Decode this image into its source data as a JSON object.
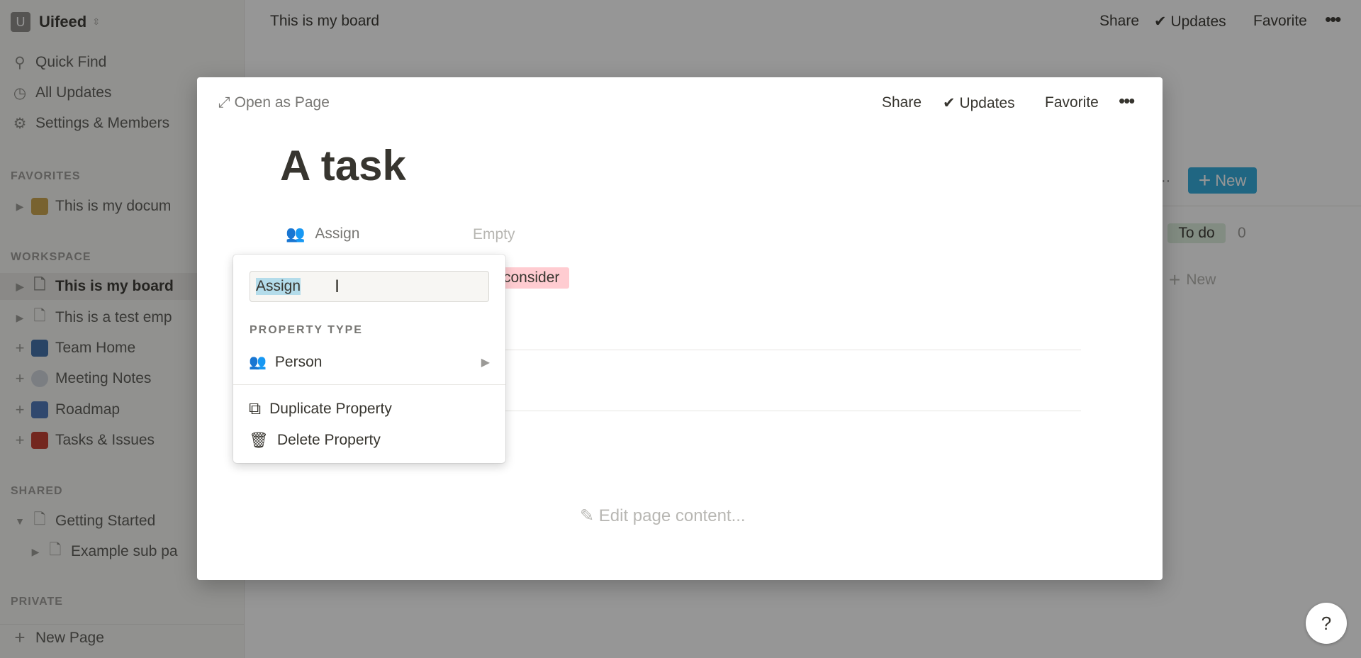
{
  "workspace": {
    "initial": "U",
    "name": "Uifeed"
  },
  "sidebar": {
    "nav": [
      {
        "label": "Quick Find",
        "icon": "search-icon"
      },
      {
        "label": "All Updates",
        "icon": "clock-icon"
      },
      {
        "label": "Settings & Members",
        "icon": "gear-icon"
      }
    ],
    "favorites_heading": "FAVORITES",
    "favorites": [
      {
        "label": "This is my docum",
        "icon": "scared-cat-emoji"
      }
    ],
    "workspace_heading": "WORKSPACE",
    "workspace_items": [
      {
        "label": "This is my board",
        "icon": "page-icon",
        "toggle": "▶",
        "active": true
      },
      {
        "label": "This is a test emp",
        "icon": "page-icon",
        "toggle": "▶"
      },
      {
        "label": "Team Home",
        "icon": "team-emoji",
        "toggle": "+"
      },
      {
        "label": "Meeting Notes",
        "icon": "speech-emoji",
        "toggle": "+"
      },
      {
        "label": "Roadmap",
        "icon": "truck-emoji",
        "toggle": "+"
      },
      {
        "label": "Tasks & Issues",
        "icon": "mailbox-emoji",
        "toggle": "+"
      }
    ],
    "shared_heading": "SHARED",
    "shared": [
      {
        "label": "Getting Started",
        "toggle": "▼"
      },
      {
        "label": "Example sub pa",
        "toggle": "▶"
      }
    ],
    "private_heading": "PRIVATE",
    "new_page": "New Page"
  },
  "topbar": {
    "title": "This is my board",
    "share": "Share",
    "updates": "Updates",
    "favorite": "Favorite"
  },
  "board": {
    "new_label": "New",
    "group": "To do",
    "count": "0",
    "add_label": "New",
    "accent": "#2eaadc"
  },
  "modal": {
    "open_as_page": "Open as Page",
    "share": "Share",
    "updates": "Updates",
    "favorite": "Favorite",
    "title": "A task",
    "property": {
      "label": "Assign",
      "value": "Empty"
    },
    "tag": "consider",
    "edit_placeholder": "Edit page content..."
  },
  "popup": {
    "input_value": "Assign",
    "section": "PROPERTY TYPE",
    "type": "Person",
    "duplicate": "Duplicate Property",
    "delete": "Delete Property"
  },
  "help": "?"
}
